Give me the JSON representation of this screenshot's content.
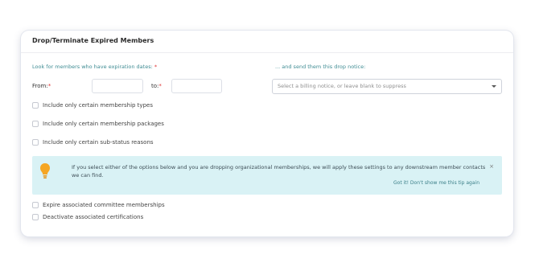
{
  "panel": {
    "title": "Drop/Terminate Expired Members",
    "look_label": "Look for members who have expiration dates:",
    "required_mark": "*",
    "send_label": "... and send them this drop notice:"
  },
  "dates": {
    "from_label": "From:",
    "to_label": "to:",
    "from_value": "",
    "to_value": ""
  },
  "notice_select": {
    "placeholder": "Select a billing notice, or leave blank to suppress"
  },
  "filters": [
    {
      "label": "Include only certain membership types",
      "checked": false
    },
    {
      "label": "Include only certain membership packages",
      "checked": false
    },
    {
      "label": "Include only certain sub-status reasons",
      "checked": false
    }
  ],
  "tip": {
    "text": "If you select either of the options below and you are dropping organizational memberships, we will apply these settings to any downstream member contacts we can find.",
    "dismiss_label": "Got it! Don't show me this tip again",
    "close_glyph": "×",
    "icon": "lightbulb-icon",
    "icon_color": "#f5a623"
  },
  "options": [
    {
      "label": "Expire associated committee memberships",
      "checked": false
    },
    {
      "label": "Deactivate associated certifications",
      "checked": false
    }
  ],
  "colors": {
    "accent_teal": "#3f8c93",
    "tip_background": "#d9f2f5",
    "required": "#dd3333"
  }
}
